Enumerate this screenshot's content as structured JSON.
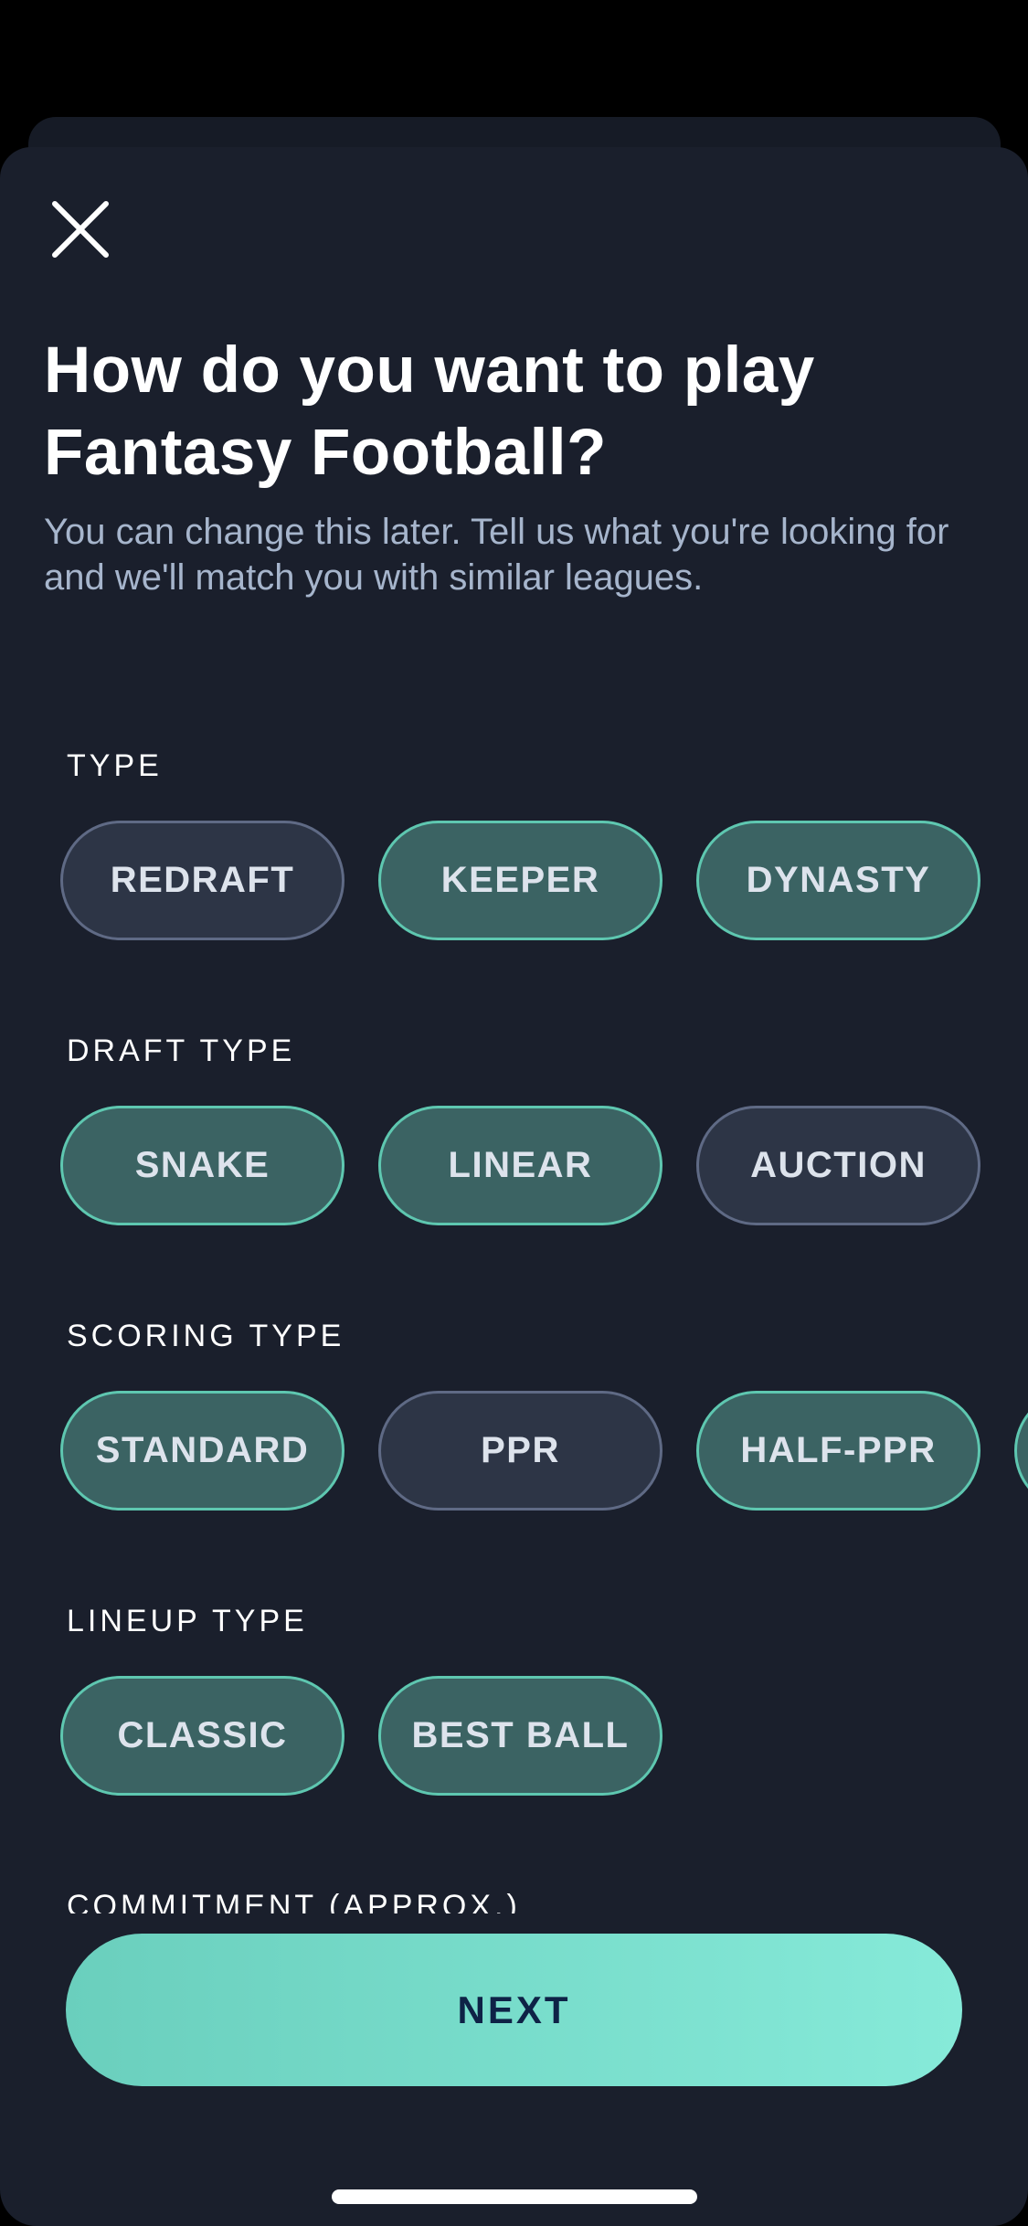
{
  "header": {
    "close_icon": "close-icon",
    "title": "How do you want to play Fantasy Football?",
    "subtitle": "You can change this later. Tell us what you're looking for and we'll match you with similar leagues."
  },
  "sections": [
    {
      "label": "TYPE",
      "options": [
        {
          "label": "REDRAFT",
          "selected": false
        },
        {
          "label": "KEEPER",
          "selected": true
        },
        {
          "label": "DYNASTY",
          "selected": true
        }
      ]
    },
    {
      "label": "DRAFT TYPE",
      "options": [
        {
          "label": "SNAKE",
          "selected": true
        },
        {
          "label": "LINEAR",
          "selected": true
        },
        {
          "label": "AUCTION",
          "selected": false
        }
      ]
    },
    {
      "label": "SCORING TYPE",
      "options": [
        {
          "label": "STANDARD",
          "selected": true
        },
        {
          "label": "PPR",
          "selected": false
        },
        {
          "label": "HALF-PPR",
          "selected": true
        },
        {
          "label": "",
          "selected": true
        }
      ]
    },
    {
      "label": "LINEUP TYPE",
      "options": [
        {
          "label": "CLASSIC",
          "selected": true
        },
        {
          "label": "BEST BALL",
          "selected": true
        }
      ]
    },
    {
      "label": "COMMITMENT (APPROX.)",
      "options": []
    }
  ],
  "footer": {
    "next_label": "NEXT"
  },
  "colors": {
    "background": "#1a1f2c",
    "selected_fill": "#3b6363",
    "selected_border": "#5ec7b0",
    "unselected_fill": "#2d3546",
    "unselected_border": "#5f6a85",
    "accent_gradient_start": "#6acfbd",
    "accent_gradient_end": "#86ead9",
    "next_text": "#0e2246"
  }
}
